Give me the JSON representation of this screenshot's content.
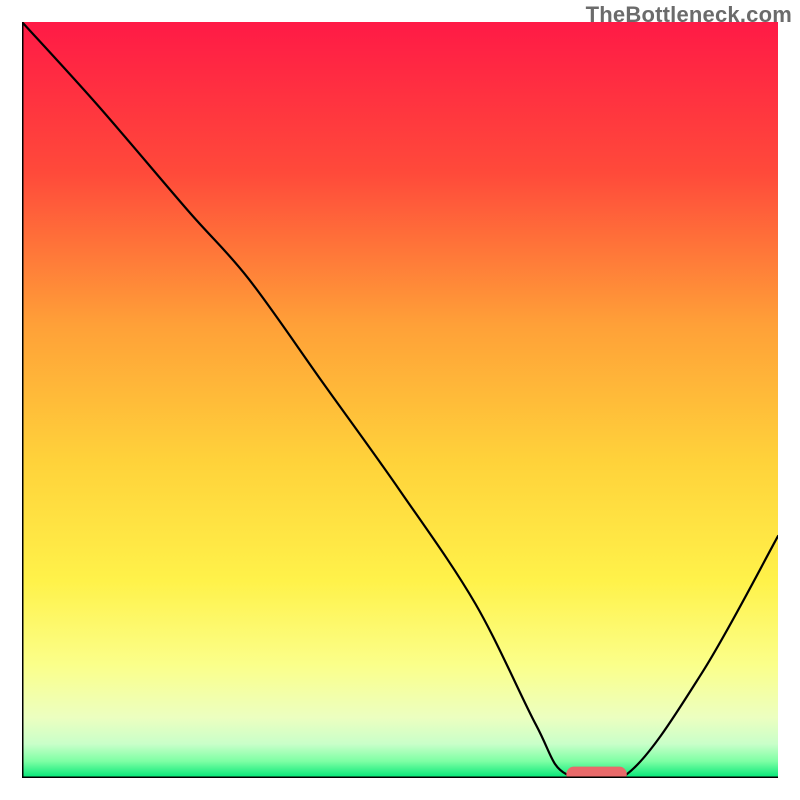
{
  "watermark": "TheBottleneck.com",
  "chart_data": {
    "type": "line",
    "title": "",
    "xlabel": "",
    "ylabel": "",
    "xlim": [
      0,
      100
    ],
    "ylim": [
      0,
      100
    ],
    "background_gradient": {
      "stops": [
        {
          "offset": 0.0,
          "color": "#ff1a46"
        },
        {
          "offset": 0.2,
          "color": "#ff4a3a"
        },
        {
          "offset": 0.4,
          "color": "#ffa038"
        },
        {
          "offset": 0.58,
          "color": "#ffd23a"
        },
        {
          "offset": 0.74,
          "color": "#fff24a"
        },
        {
          "offset": 0.85,
          "color": "#fbff8a"
        },
        {
          "offset": 0.92,
          "color": "#ecffc0"
        },
        {
          "offset": 0.955,
          "color": "#c9ffc9"
        },
        {
          "offset": 0.978,
          "color": "#7dffa4"
        },
        {
          "offset": 1.0,
          "color": "#00e676"
        }
      ]
    },
    "series": [
      {
        "name": "bottleneck-curve",
        "color": "#000000",
        "stroke_width": 2.2,
        "x": [
          0,
          10,
          22,
          30,
          40,
          50,
          60,
          68,
          72,
          80,
          90,
          100
        ],
        "y": [
          100,
          89,
          75,
          66,
          52,
          38,
          23,
          7,
          0.5,
          0.5,
          14,
          32
        ]
      }
    ],
    "marker": {
      "name": "optimal-range",
      "shape": "capsule",
      "color": "#e86a6a",
      "x_center": 76,
      "y": 0.5,
      "width_x": 8,
      "height_y": 2.0
    },
    "axes": {
      "color": "#000000",
      "width": 3
    }
  }
}
